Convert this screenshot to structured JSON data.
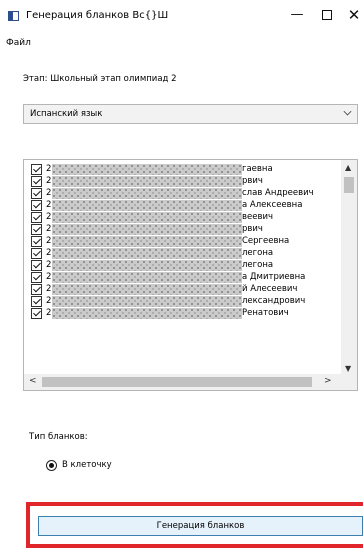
{
  "window": {
    "title": "Генерация бланков Вс{}Ш",
    "minimize": "—",
    "close": "✕"
  },
  "menu": {
    "file": "Файл"
  },
  "stage": {
    "label": "Этап: Школьный этап олимпиад 2"
  },
  "subject": {
    "selected": "Испанский язык"
  },
  "participants": [
    {
      "id": "2",
      "visible_text": "гаевна"
    },
    {
      "id": "2",
      "visible_text": "рвич"
    },
    {
      "id": "2",
      "visible_text": "слав Андреевич"
    },
    {
      "id": "2",
      "visible_text": "а Алексеевна"
    },
    {
      "id": "2",
      "visible_text": "веевич"
    },
    {
      "id": "2",
      "visible_text": "рвич"
    },
    {
      "id": "2",
      "visible_text": "Сергеевна"
    },
    {
      "id": "2",
      "visible_text": "легона"
    },
    {
      "id": "2",
      "visible_text": "легона"
    },
    {
      "id": "2",
      "visible_text": "а Дмитриевна"
    },
    {
      "id": "2",
      "visible_text": "й Алесеевич"
    },
    {
      "id": "2",
      "visible_text": "лександрович"
    },
    {
      "id": "2",
      "visible_text": "Ренатович"
    }
  ],
  "blank_type": {
    "label": "Тип бланков:",
    "option": "В клеточку"
  },
  "generate_button": {
    "label": "Генерация бланков"
  },
  "colors": {
    "highlight": "#e0262b",
    "button_bg": "#e5f1fb",
    "button_border": "#3c7fb1"
  }
}
